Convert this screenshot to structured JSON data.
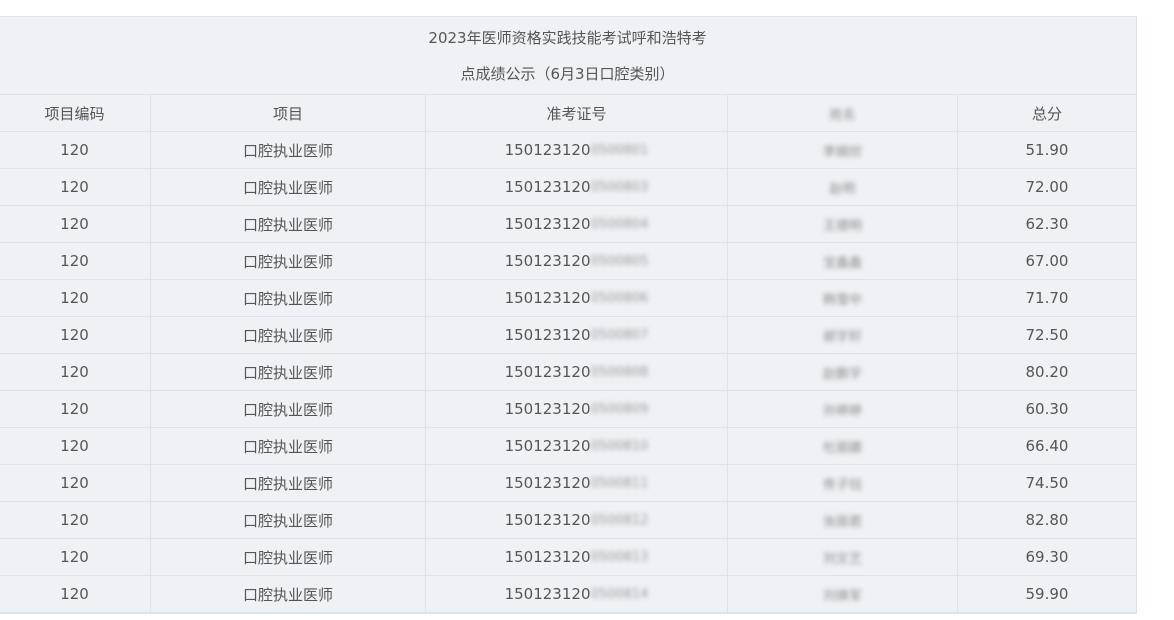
{
  "title": {
    "line1": "2023年医师资格实践技能考试呼和浩特考",
    "line2": "点成绩公示（6月3日口腔类别）"
  },
  "columns": [
    "项目编码",
    "项目",
    "准考证号",
    "姓名",
    "总分"
  ],
  "rows": [
    {
      "code": "120",
      "item": "口腔执业医师",
      "id_prefix": "150123120",
      "id_suffix": "0500801",
      "name": "李婉欣",
      "score": "51.90"
    },
    {
      "code": "120",
      "item": "口腔执业医师",
      "id_prefix": "150123120",
      "id_suffix": "0500803",
      "name": "赵明",
      "score": "72.00"
    },
    {
      "code": "120",
      "item": "口腔执业医师",
      "id_prefix": "150123120",
      "id_suffix": "0500804",
      "name": "王德明",
      "score": "62.30"
    },
    {
      "code": "120",
      "item": "口腔执业医师",
      "id_prefix": "150123120",
      "id_suffix": "0500805",
      "name": "宝鑫鑫",
      "score": "67.00"
    },
    {
      "code": "120",
      "item": "口腔执业医师",
      "id_prefix": "150123120",
      "id_suffix": "0500806",
      "name": "韩雪中",
      "score": "71.70"
    },
    {
      "code": "120",
      "item": "口腔执业医师",
      "id_prefix": "150123120",
      "id_suffix": "0500807",
      "name": "郝宇轩",
      "score": "72.50"
    },
    {
      "code": "120",
      "item": "口腔执业医师",
      "id_prefix": "150123120",
      "id_suffix": "0500808",
      "name": "赵鹏宇",
      "score": "80.20"
    },
    {
      "code": "120",
      "item": "口腔执业医师",
      "id_prefix": "150123120",
      "id_suffix": "0500809",
      "name": "孙婷婷",
      "score": "60.30"
    },
    {
      "code": "120",
      "item": "口腔执业医师",
      "id_prefix": "150123120",
      "id_suffix": "0500810",
      "name": "杜丽娜",
      "score": "66.40"
    },
    {
      "code": "120",
      "item": "口腔执业医师",
      "id_prefix": "150123120",
      "id_suffix": "0500811",
      "name": "佟子钰",
      "score": "74.50"
    },
    {
      "code": "120",
      "item": "口腔执业医师",
      "id_prefix": "150123120",
      "id_suffix": "0500812",
      "name": "张丽君",
      "score": "82.80"
    },
    {
      "code": "120",
      "item": "口腔执业医师",
      "id_prefix": "150123120",
      "id_suffix": "0500813",
      "name": "刘文艺",
      "score": "69.30"
    },
    {
      "code": "120",
      "item": "口腔执业医师",
      "id_prefix": "150123120",
      "id_suffix": "0500814",
      "name": "刘焕军",
      "score": "59.90"
    }
  ]
}
